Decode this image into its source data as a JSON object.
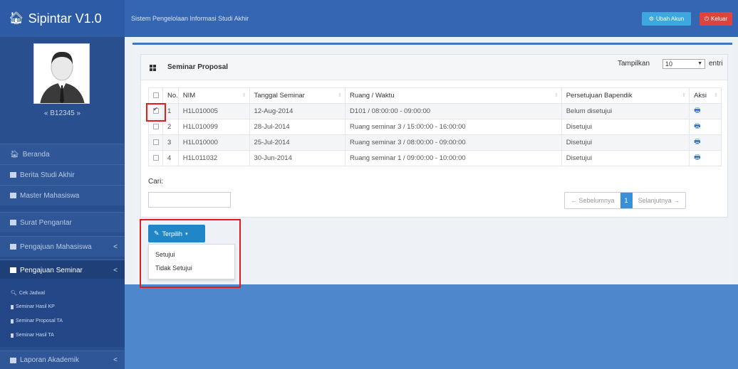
{
  "app": {
    "title": "Sipintar V1.0",
    "subtitle": "Sistem Pengelolaan Informasi Studi Akhir"
  },
  "header": {
    "ubah_akun": "Ubah Akun",
    "keluar": "Keluar"
  },
  "user": {
    "id": "« B12345 »"
  },
  "sidebar": {
    "items": [
      {
        "label": "Beranda"
      },
      {
        "label": "Berita Studi Akhir"
      },
      {
        "label": "Master Mahasiswa"
      },
      {
        "label": "Surat Pengantar"
      },
      {
        "label": "Pengajuan Mahasiswa",
        "chevron": "<"
      },
      {
        "label": "Pengajuan Seminar",
        "chevron": "<"
      },
      {
        "label": "Laporan Akademik",
        "chevron": "<"
      }
    ],
    "sub_items": [
      {
        "label": "Cek Jadwal"
      },
      {
        "label": "Seminar Hasil KP"
      },
      {
        "label": "Seminar Proposal TA"
      },
      {
        "label": "Seminar Hasil TA"
      }
    ]
  },
  "panel": {
    "title": "Seminar Proposal",
    "show_label": "Tampilkan",
    "show_value": "10",
    "entries_label": "entri",
    "columns": [
      "No.",
      "NIM",
      "Tanggal Seminar",
      "Ruang / Waktu",
      "Persetujuan Bapendik",
      "Aksi"
    ],
    "rows": [
      {
        "checked": true,
        "no": "1",
        "nim": "H1L010005",
        "tanggal": "12-Aug-2014",
        "ruang": "D101 / 08:00:00 - 09:00:00",
        "status": "Belum disetujui"
      },
      {
        "checked": false,
        "no": "2",
        "nim": "H1L010099",
        "tanggal": "28-Jul-2014",
        "ruang": "Ruang seminar 3 / 15:00:00 - 16:00:00",
        "status": "Disetujui"
      },
      {
        "checked": false,
        "no": "3",
        "nim": "H1L010000",
        "tanggal": "25-Jul-2014",
        "ruang": "Ruang seminar 3 / 08:00:00 - 09:00:00",
        "status": "Disetujui"
      },
      {
        "checked": false,
        "no": "4",
        "nim": "H1L011032",
        "tanggal": "30-Jun-2014",
        "ruang": "Ruang seminar 1 / 09:00:00 - 10:00:00",
        "status": "Disetujui"
      }
    ],
    "search_label": "Cari:",
    "pager": {
      "prev": "← Sebelumnya",
      "current": "1",
      "next": "Selanjutnya →"
    }
  },
  "actions": {
    "button": "Terpilih",
    "menu": [
      "Setujui",
      "Tidak Setujui"
    ]
  },
  "colors": {
    "highlight": "#e41b1b",
    "accent": "#3b78c6"
  }
}
